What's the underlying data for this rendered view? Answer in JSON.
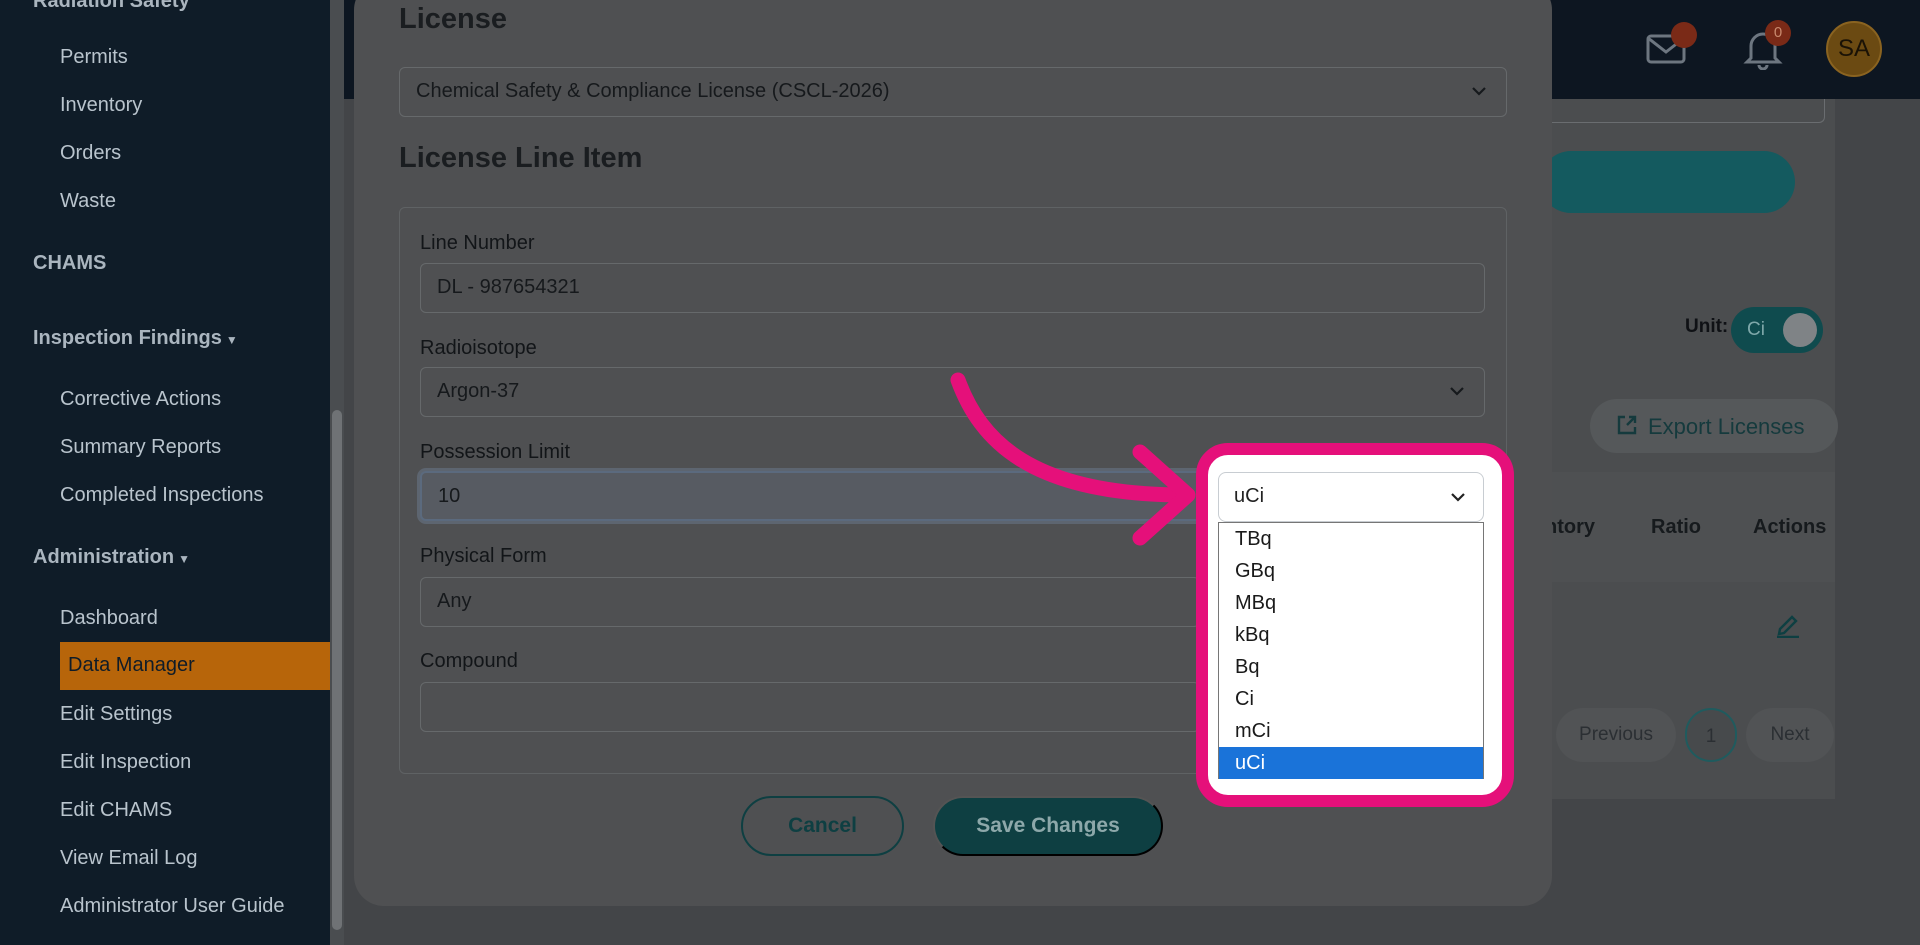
{
  "sidebar": {
    "section_top": "Radiation Safety",
    "items_top": [
      "Permits",
      "Inventory",
      "Orders",
      "Waste"
    ],
    "chams": "CHAMS",
    "inspection_findings": "Inspection Findings",
    "inspection_items": [
      "Corrective Actions",
      "Summary Reports",
      "Completed Inspections"
    ],
    "administration": "Administration",
    "admin_items": [
      "Dashboard",
      "Data Manager",
      "Edit Settings",
      "Edit Inspection",
      "Edit CHAMS",
      "View Email Log",
      "Administrator User Guide"
    ]
  },
  "header": {
    "mail_badge": "",
    "bell_badge": "0",
    "avatar": "SA"
  },
  "page": {
    "unit_label": "Unit:",
    "unit_toggle": "Ci",
    "export_button": "Export Licenses",
    "columns": [
      "ntory",
      "Ratio",
      "Actions"
    ],
    "pagination": {
      "previous": "Previous",
      "page": "1",
      "next": "Next"
    }
  },
  "modal": {
    "license_title": "License",
    "license_value": "Chemical Safety & Compliance License (CSCL-2026)",
    "line_item_title": "License Line Item",
    "line_number_label": "Line Number",
    "line_number_value": "DL - 987654321",
    "radioisotope_label": "Radioisotope",
    "radioisotope_value": "Argon-37",
    "possession_limit_label": "Possession Limit",
    "possession_limit_value": "10",
    "physical_form_label": "Physical Form",
    "physical_form_value": "Any",
    "compound_label": "Compound",
    "compound_value": "",
    "cancel": "Cancel",
    "save": "Save Changes"
  },
  "unit_dropdown": {
    "selected": "uCi",
    "options": [
      "TBq",
      "GBq",
      "MBq",
      "kBq",
      "Bq",
      "Ci",
      "mCi",
      "uCi"
    ]
  },
  "colors": {
    "highlight": "#e5107a",
    "accent_teal": "#0e3f42",
    "selected_option": "#1a73d9",
    "sidebar_active": "#b7650a"
  }
}
